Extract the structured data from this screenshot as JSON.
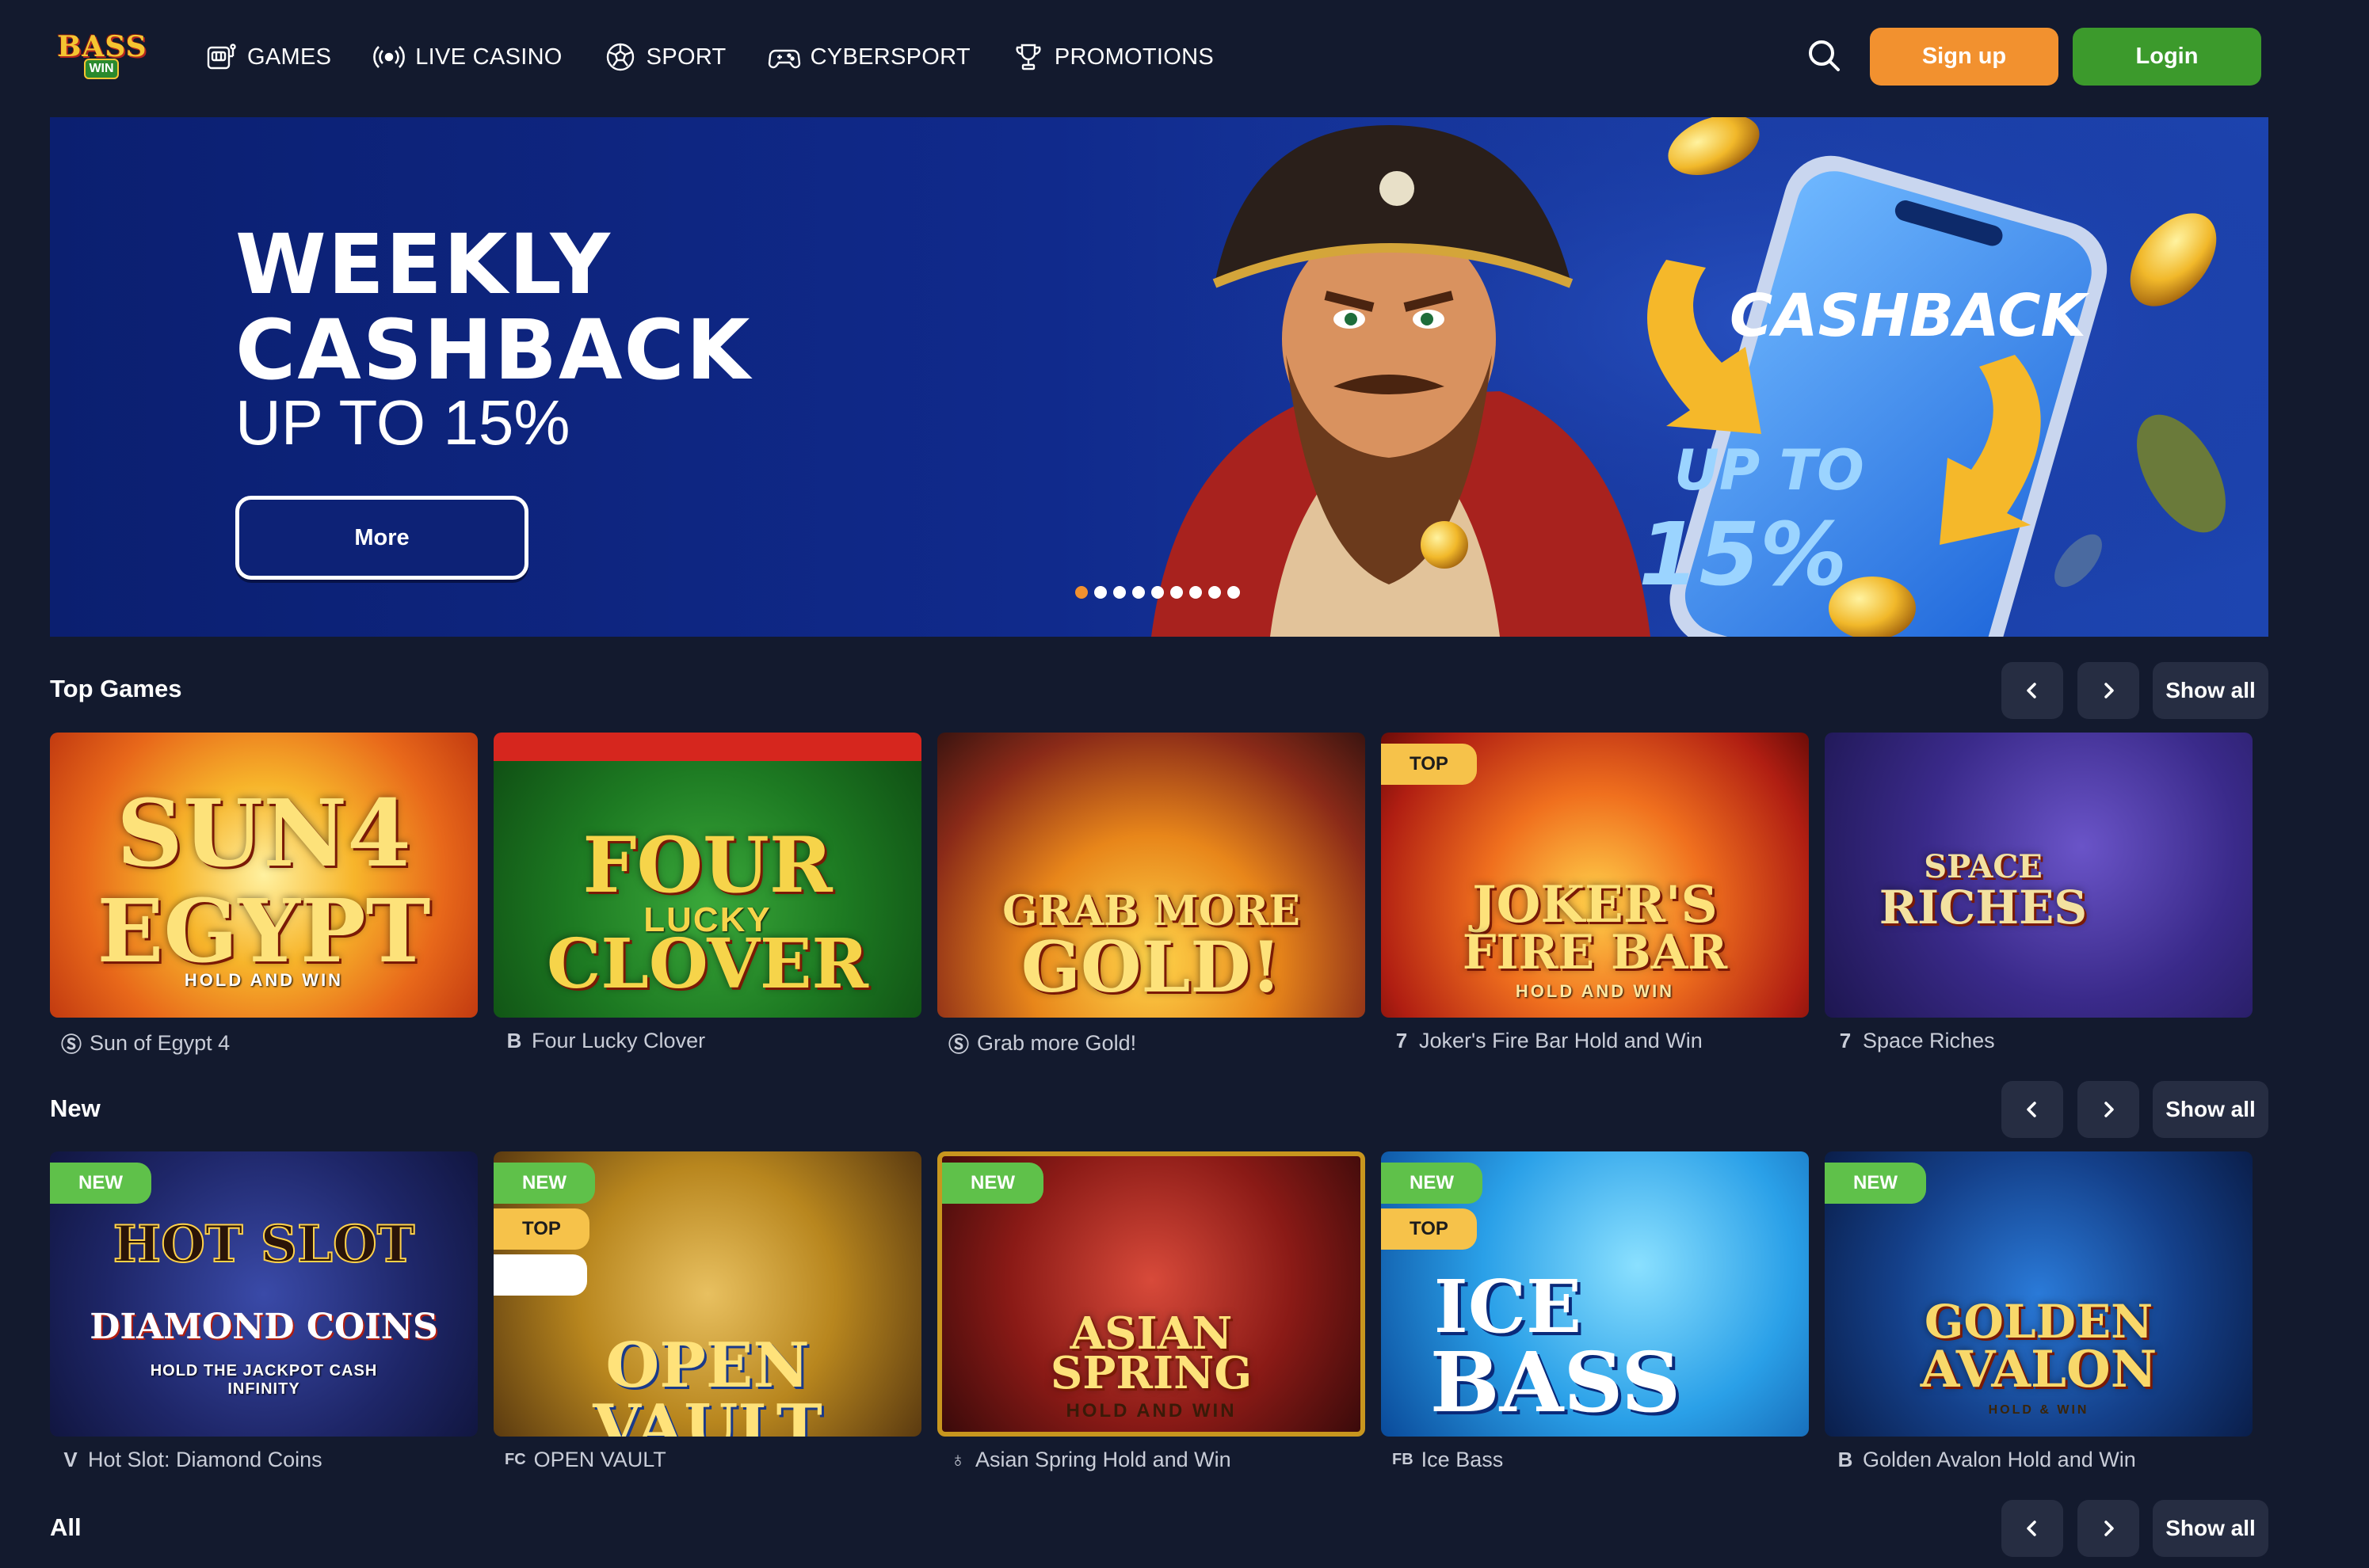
{
  "header": {
    "logo_top": "BASS",
    "logo_bottom": "WIN",
    "nav": [
      {
        "label": "GAMES",
        "icon": "slot-machine-icon"
      },
      {
        "label": "LIVE CASINO",
        "icon": "broadcast-icon"
      },
      {
        "label": "SPORT",
        "icon": "soccer-ball-icon"
      },
      {
        "label": "CYBERSPORT",
        "icon": "gamepad-icon"
      },
      {
        "label": "PROMOTIONS",
        "icon": "trophy-icon"
      }
    ],
    "signup": "Sign up",
    "login": "Login"
  },
  "banner": {
    "title_line1": "WEEKLY",
    "title_line2": "CASHBACK",
    "subtitle": "UP TO 15%",
    "more": "More",
    "phone_text": "CASHBACK",
    "phone_upto": "UP TO",
    "phone_pct": "15%",
    "slides": 9,
    "active_slide": 0
  },
  "sections": [
    {
      "title": "Top Games",
      "show_all": "Show all"
    },
    {
      "title": "New",
      "show_all": "Show all"
    },
    {
      "title": "All",
      "show_all": "Show all"
    }
  ],
  "top_games": [
    {
      "name": "Sun of Egypt 4",
      "provider": "Ⓢ",
      "art_line1": "SUN4",
      "art_line2": "EGYPT",
      "art_sub": "HOLD AND WIN"
    },
    {
      "name": "Four Lucky Clover",
      "provider": "B",
      "art_line1": "FOUR",
      "art_line2": "CLOVER",
      "art_sub": "LUCKY"
    },
    {
      "name": "Grab more Gold!",
      "provider": "Ⓢ",
      "art_line1": "GRAB MORE",
      "art_line2": "GOLD!",
      "art_sub": ""
    },
    {
      "name": "Joker's Fire Bar Hold and Win",
      "provider": "7",
      "art_line1": "JOKER'S",
      "art_line2": "FIRE BAR",
      "art_sub": "HOLD AND WIN",
      "badge_top": "TOP"
    },
    {
      "name": "Space Riches",
      "provider": "7",
      "art_line1": "SPACE",
      "art_line2": "RICHES",
      "art_sub": ""
    }
  ],
  "new_games": [
    {
      "name": "Hot Slot: Diamond Coins",
      "provider": "V",
      "art_line1": "HOT SLOT",
      "art_line2": "DIAMOND COINS",
      "art_sub": "HOLD THE JACKPOT CASH INFINITY",
      "badge_new": "NEW"
    },
    {
      "name": "OPEN VAULT",
      "provider": "FC",
      "art_line1": "",
      "art_line2": "OPEN VAULT",
      "art_sub": "",
      "badge_new": "NEW",
      "badge_top": "TOP"
    },
    {
      "name": "Asian Spring Hold and Win",
      "provider": "♁",
      "art_line1": "ASIAN",
      "art_line2": "SPRING",
      "art_sub": "HOLD AND WIN",
      "badge_new": "NEW"
    },
    {
      "name": "Ice Bass",
      "provider": "FB",
      "art_line1": "ICE",
      "art_line2": "BASS",
      "art_sub": "",
      "badge_new": "NEW",
      "badge_top": "TOP"
    },
    {
      "name": "Golden Avalon Hold and Win",
      "provider": "B",
      "art_line1": "GOLDEN",
      "art_line2": "AVALON",
      "art_sub": "HOLD & WIN",
      "badge_new": "NEW"
    }
  ],
  "colors": {
    "background": "#131a2e",
    "signup": "#f2912f",
    "login": "#3c9a2c",
    "control": "#262d42",
    "badge_new": "#5fc14a",
    "badge_top": "#f6c24a"
  }
}
